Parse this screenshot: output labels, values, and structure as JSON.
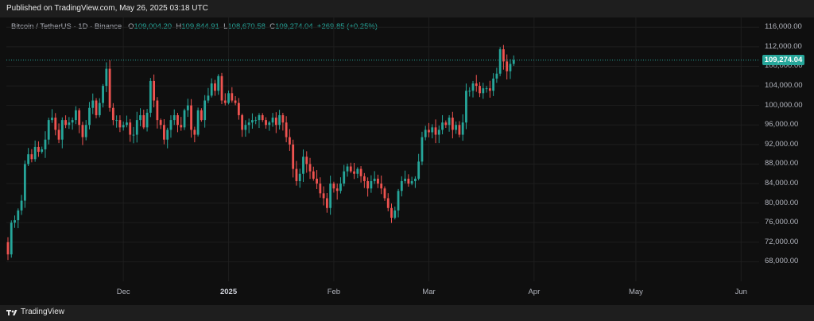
{
  "header": {
    "published": "Published on TradingView.com, May 26, 2025 03:18 UTC"
  },
  "legend": {
    "symbol": "Bitcoin / TetherUS · 1D · Binance",
    "open_label": "O",
    "open": "109,004.20",
    "high_label": "H",
    "high": "109,844.91",
    "low_label": "L",
    "low": "108,670.58",
    "close_label": "C",
    "close": "109,274.04",
    "change": "+269.85 (+0.25%)"
  },
  "footer": {
    "brand": "TradingView"
  },
  "colors": {
    "up": "#26a69a",
    "down": "#ef5350",
    "background": "#0f0f0f",
    "grid": "#1e1e1e"
  },
  "chart_data": {
    "type": "candlestick",
    "ylim": [
      64000,
      118000
    ],
    "y_ticks": [
      "116,000.00",
      "112,000.00",
      "108,000.00",
      "104,000.00",
      "100,000.00",
      "96,000.00",
      "92,000.00",
      "88,000.00",
      "84,000.00",
      "80,000.00",
      "76,000.00",
      "72,000.00",
      "68,000.00"
    ],
    "y_tick_values": [
      116000,
      112000,
      108000,
      104000,
      100000,
      96000,
      92000,
      88000,
      84000,
      80000,
      76000,
      72000,
      68000
    ],
    "x_ticks": [
      {
        "label": "Dec",
        "index": 34
      },
      {
        "label": "2025",
        "index": 65
      },
      {
        "label": "Feb",
        "index": 96
      },
      {
        "label": "Mar",
        "index": 124
      },
      {
        "label": "Apr",
        "index": 155
      },
      {
        "label": "May",
        "index": 185
      },
      {
        "label": "Jun",
        "index": 216
      }
    ],
    "last_price": 109274.04,
    "last_price_label": "109,274.04",
    "closes": [
      69500,
      76000,
      76500,
      78500,
      80500,
      88000,
      90000,
      89000,
      91500,
      90500,
      91000,
      93000,
      97000,
      97500,
      95000,
      93000,
      97000,
      96000,
      96500,
      97000,
      99000,
      96000,
      93500,
      96000,
      99500,
      101000,
      98000,
      100500,
      104000,
      107500,
      99500,
      97000,
      97000,
      95500,
      96000,
      96500,
      94000,
      94000,
      97000,
      98000,
      95500,
      98500,
      105000,
      101000,
      97000,
      96000,
      93000,
      95000,
      97000,
      98000,
      96000,
      95500,
      99000,
      100000,
      95000,
      94000,
      99000,
      97000,
      101000,
      102000,
      104500,
      103000,
      106000,
      101000,
      100500,
      102500,
      101000,
      100500,
      98000,
      95000,
      96000,
      96500,
      97000,
      97000,
      98000,
      97000,
      96000,
      96500,
      97500,
      96000,
      98000,
      96500,
      93500,
      92000,
      87000,
      84500,
      86000,
      89500,
      88000,
      86500,
      85000,
      84000,
      82000,
      81000,
      79000,
      84000,
      83000,
      82500,
      84000,
      86500,
      87500,
      86500,
      86000,
      87000,
      85500,
      84500,
      83000,
      84500,
      85000,
      84000,
      83000,
      81000,
      79000,
      77000,
      78500,
      82500,
      84500,
      85000,
      84000,
      84500,
      85000,
      88500,
      93500,
      95000,
      94500,
      95500,
      94000,
      95000,
      96500,
      96000,
      97500,
      95000,
      96000,
      94000,
      96500,
      103000,
      103000,
      104500,
      104000,
      102500,
      103500,
      103500,
      103000,
      105500,
      106500,
      111500,
      109000,
      107000,
      108500,
      109274
    ]
  }
}
